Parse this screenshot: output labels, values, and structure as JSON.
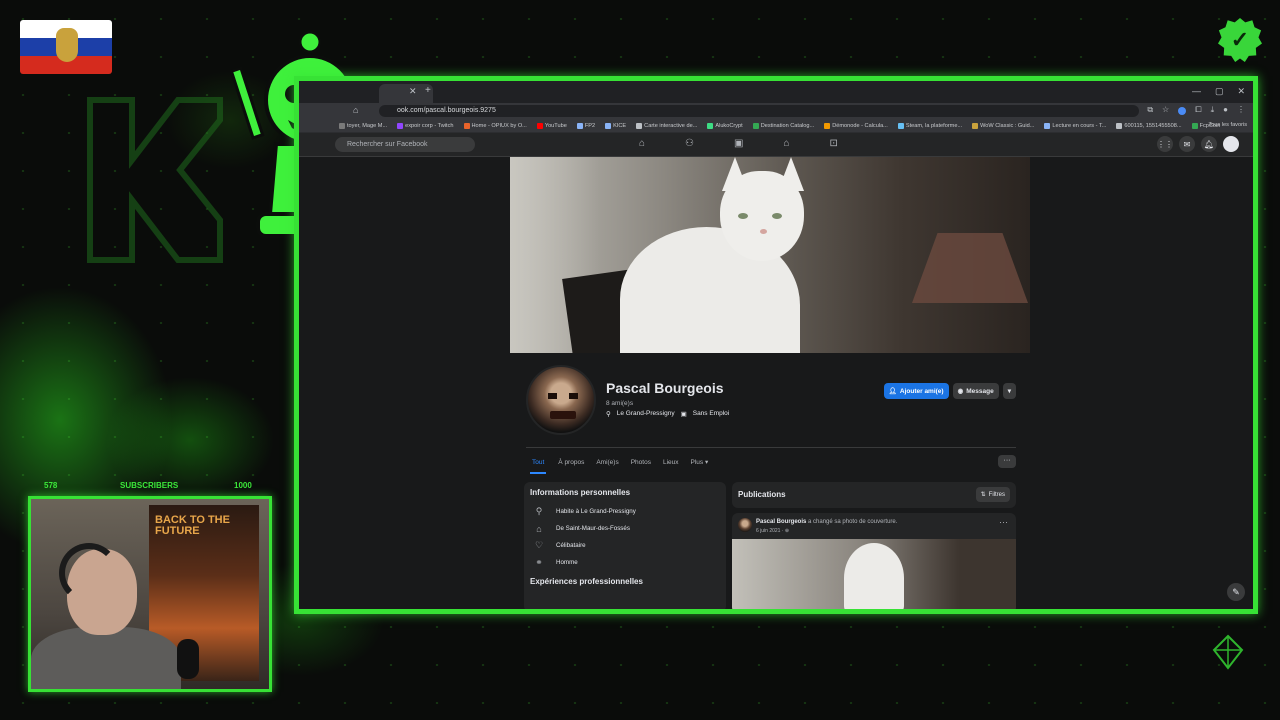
{
  "overlay": {
    "subscribers_label": "SUBSCRIBERS",
    "subscribers_current": "578",
    "subscribers_goal": "1000",
    "logo_icon": "k-logo-icon",
    "mascot_icon": "chess-pawn-mascot-icon",
    "flag_icon": "russian-flag-icon",
    "verified_icon": "verified-badge-icon",
    "accent_color": "#37e235"
  },
  "webcam": {
    "poster_title": "BACK TO THE FUTURE"
  },
  "browser": {
    "url": "ook.com/pascal.bourgeois.9275",
    "bookmarks": [
      {
        "label": "toyer, Mage M...",
        "color": "#7a7a7a"
      },
      {
        "label": "expoir corp - Twitch",
        "color": "#9146ff"
      },
      {
        "label": "Home - OPIUX by O...",
        "color": "#e8632a"
      },
      {
        "label": "YouTube",
        "color": "#ff0000"
      },
      {
        "label": "FP2",
        "color": "#8ab4f8"
      },
      {
        "label": "KICE",
        "color": "#8ab4f8"
      },
      {
        "label": "Carte interactive de...",
        "color": "#bdc1c6"
      },
      {
        "label": "AlukoCrypt",
        "color": "#3ddc84"
      },
      {
        "label": "Destination Catalog...",
        "color": "#34a853"
      },
      {
        "label": "Démonode - Calcula...",
        "color": "#f29900"
      },
      {
        "label": "Steam, la plateforme...",
        "color": "#66c0f4"
      },
      {
        "label": "WoW Classic : Guid...",
        "color": "#c9a23c"
      },
      {
        "label": "Lecture en cours - T...",
        "color": "#8ab4f8"
      },
      {
        "label": "600115, 1551455508...",
        "color": "#bdc1c6"
      },
      {
        "label": "FcpCoin",
        "color": "#34a853"
      }
    ],
    "all_bookmarks": "Tous les favoris"
  },
  "facebook": {
    "search_placeholder": "Rechercher sur Facebook",
    "profile": {
      "name": "Pascal Bourgeois",
      "friends": "8 ami(e)s",
      "location": "Le Grand-Pressigny",
      "job": "Sans Emploi"
    },
    "buttons": {
      "add_friend": "Ajouter ami(e)",
      "message": "Message"
    },
    "tabs": [
      "Tout",
      "À propos",
      "Ami(e)s",
      "Photos",
      "Lieux",
      "Plus"
    ],
    "intro": {
      "title": "Informations personnelles",
      "items": [
        {
          "icon": "location-pin-icon",
          "text": "Habite à Le Grand-Pressigny"
        },
        {
          "icon": "home-icon",
          "text": "De Saint-Maur-des-Fossés"
        },
        {
          "icon": "heart-icon",
          "text": "Célibataire"
        },
        {
          "icon": "gender-icon",
          "text": "Homme"
        }
      ],
      "work_title": "Expériences professionnelles"
    },
    "posts": {
      "title": "Publications",
      "filters_label": "Filtres",
      "post_author": "Pascal Bourgeois",
      "post_action": "a changé sa photo de couverture.",
      "post_date": "6 juin 2021 · ⊕"
    }
  }
}
